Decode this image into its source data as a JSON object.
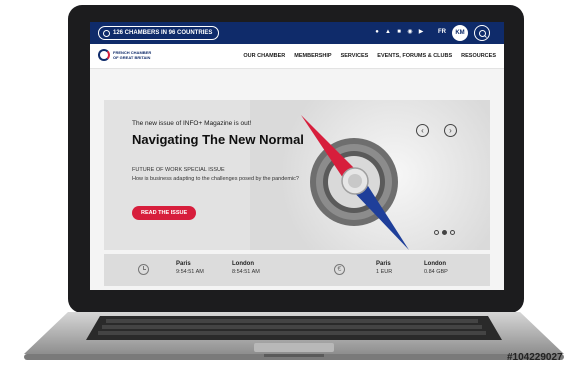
{
  "topbar": {
    "chambers_label": "126 CHAMBERS IN 96 COUNTRIES",
    "language": "FR",
    "user_initials": "KM",
    "social_icons": [
      "messenger-icon",
      "twitter-icon",
      "facebook-icon",
      "instagram-icon",
      "youtube-icon"
    ]
  },
  "logo": {
    "line1": "FRENCH CHAMBER",
    "line2": "OF GREAT BRITAIN"
  },
  "nav": {
    "items": [
      "OUR CHAMBER",
      "MEMBERSHIP",
      "SERVICES",
      "EVENTS, FORUMS & CLUBS",
      "RESOURCES"
    ]
  },
  "hero": {
    "kicker": "The new issue of INFO+ Magazine is out!",
    "headline": "Navigating The New Normal",
    "subtitle": "FUTURE OF WORK SPECIAL ISSUE",
    "question": "How is business adapting to the challenges posed by the pandemic?",
    "cta": "READ THE ISSUE",
    "prev_arrow": "‹",
    "next_arrow": "›"
  },
  "ticker": {
    "time": [
      {
        "city": "Paris",
        "value": "9:54:51 AM"
      },
      {
        "city": "London",
        "value": "8:54:51 AM"
      }
    ],
    "currency": [
      {
        "city": "Paris",
        "value": "1 EUR"
      },
      {
        "city": "London",
        "value": "0.84 GBP"
      }
    ],
    "euro_symbol": "€"
  },
  "watermark": "#104229027",
  "colors": {
    "navy": "#0f2b6a",
    "red": "#d71e3c",
    "laptop_frame": "#1c1c1e"
  }
}
